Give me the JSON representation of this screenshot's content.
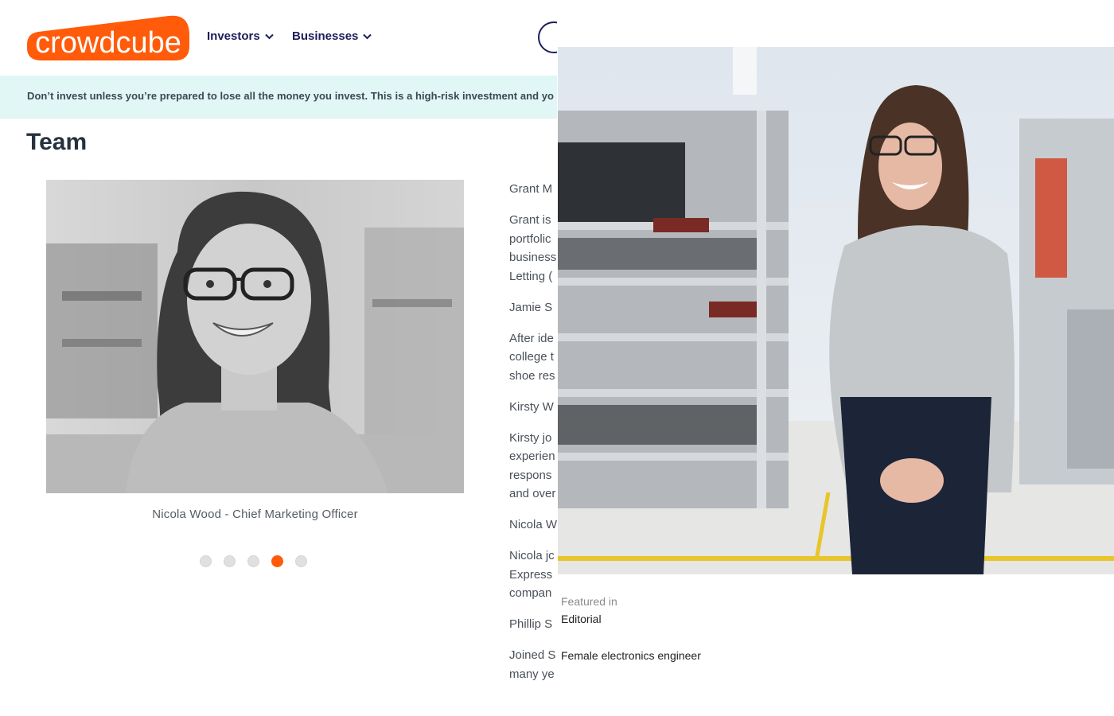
{
  "header": {
    "logo_text": "crowdcube",
    "nav": [
      {
        "label": "Investors",
        "icon": "chevron-down-icon"
      },
      {
        "label": "Businesses",
        "icon": "chevron-down-icon"
      }
    ]
  },
  "risk_banner": {
    "text": "Don’t invest unless you’re prepared to lose all the money you invest. This is a high-risk investment and yo"
  },
  "team": {
    "title": "Team",
    "carousel": {
      "caption": "Nicola Wood - Chief Marketing Officer",
      "slide_count": 5,
      "active_index": 4
    },
    "bio_lines": [
      [
        "Grant M"
      ],
      [
        "Grant is",
        "portfolic",
        "business",
        "Letting ("
      ],
      [
        "Jamie S"
      ],
      [
        "After ide",
        "college t",
        "shoe res"
      ],
      [
        "Kirsty W"
      ],
      [
        "Kirsty jo",
        "experien",
        "respons",
        "and over"
      ],
      [
        "Nicola W"
      ],
      [
        "Nicola jc",
        "Express",
        "compan"
      ],
      [
        "Phillip S"
      ],
      [
        "Joined S",
        "many ye"
      ]
    ]
  },
  "viewer": {
    "featured_label": "Featured in",
    "featured_value": "Editorial",
    "photo_title": "Female electronics engineer"
  },
  "colors": {
    "brand_orange": "#ff5b0a",
    "nav_navy": "#1d1d5c",
    "banner_bg": "#e0f7f5"
  }
}
